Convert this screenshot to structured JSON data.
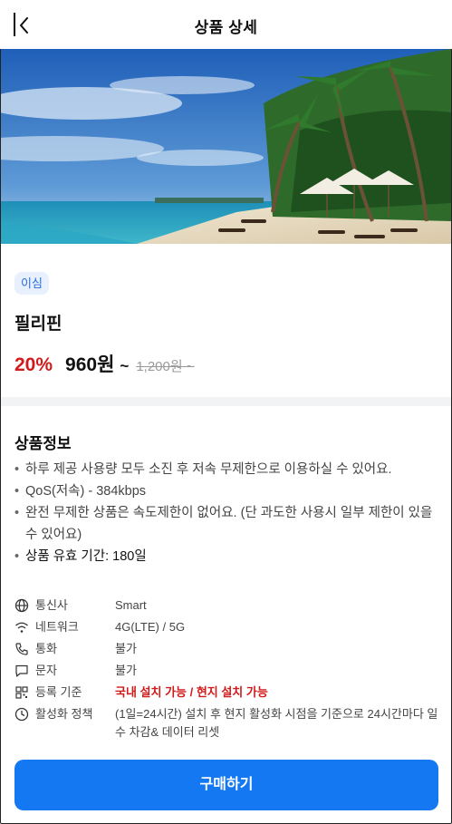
{
  "header": {
    "title": "상품 상세",
    "back_icon": "chevron-left-icon"
  },
  "hero": {
    "image_alt": "tropical beach with palm trees and umbrellas"
  },
  "product": {
    "badge": "이심",
    "name": "필리핀",
    "discount": "20%",
    "price": "960원",
    "price_suffix": "~",
    "original_price": "1,200원 ~"
  },
  "info": {
    "title": "상품정보",
    "bullets": [
      "하루 제공 사용량 모두 소진 후 저속 무제한으로 이용하실 수 있어요.",
      "QoS(저속) - 384kbps",
      "완전 무제한 상품은 속도제한이 없어요. (단 과도한 사용시 일부 제한이 있을 수 있어요)",
      "상품 유효 기간: 180일"
    ],
    "specs": [
      {
        "icon": "globe-icon",
        "label": "통신사",
        "value": "Smart"
      },
      {
        "icon": "wifi-icon",
        "label": "네트워크",
        "value": "4G(LTE) / 5G"
      },
      {
        "icon": "phone-icon",
        "label": "통화",
        "value": "불가"
      },
      {
        "icon": "message-icon",
        "label": "문자",
        "value": "불가"
      },
      {
        "icon": "qr-code-icon",
        "label": "등록 기준",
        "value": "국내 설치 가능 / 현지 설치 가능"
      },
      {
        "icon": "clock-icon",
        "label": "활성화 정책",
        "value": "(1일=24시간) 설치 후 현지 활성화 시점을 기준으로 24시간마다 일수 차감& 데이터 리셋"
      }
    ]
  },
  "cta": {
    "label": "구매하기"
  },
  "colors": {
    "accent": "#1478f2",
    "discount": "#d11a1a",
    "badge_bg": "#e8f0fd",
    "badge_text": "#2b6cd9"
  }
}
